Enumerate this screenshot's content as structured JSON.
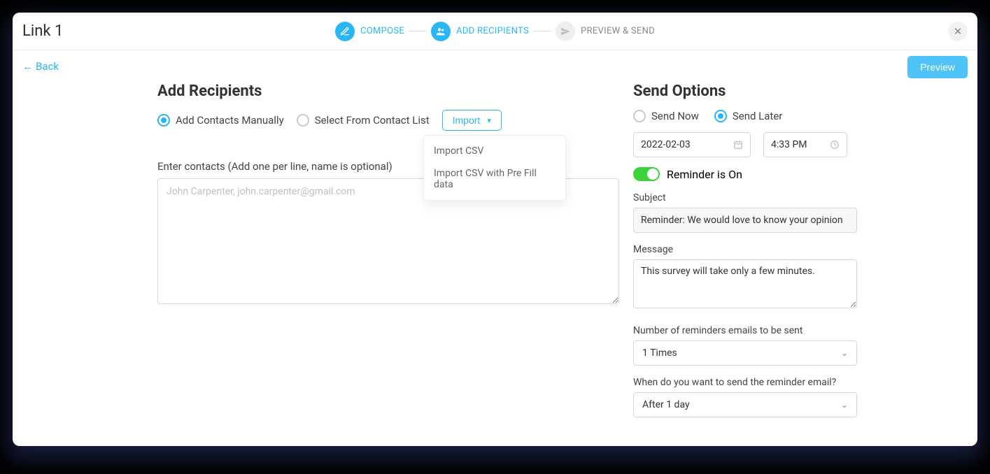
{
  "header": {
    "title": "Link 1",
    "steps": [
      {
        "label": "COMPOSE",
        "active": true
      },
      {
        "label": "ADD RECIPIENTS",
        "active": true
      },
      {
        "label": "PREVIEW & SEND",
        "active": false
      }
    ],
    "close_aria": "Close"
  },
  "subheader": {
    "back_label": "Back",
    "preview_label": "Preview"
  },
  "left": {
    "title": "Add Recipients",
    "radios": {
      "manual": "Add Contacts Manually",
      "from_list": "Select From Contact List"
    },
    "import_label": "Import",
    "import_menu": [
      "Import CSV",
      "Import CSV with Pre Fill data"
    ],
    "contacts_label": "Enter contacts (Add one per line, name is optional)",
    "contacts_placeholder": "John Carpenter, john.carpenter@gmail.com"
  },
  "right": {
    "title": "Send Options",
    "send_radios": {
      "now": "Send Now",
      "later": "Send Later"
    },
    "date_value": "2022-02-03",
    "time_value": "4:33 PM",
    "reminder_toggle_label": "Reminder is On",
    "subject_label": "Subject",
    "subject_value": "Reminder: We would love to know your opinion",
    "message_label": "Message",
    "message_value": "This survey will take only a few minutes.",
    "num_reminders_label": "Number of reminders emails to be sent",
    "num_reminders_value": "1 Times",
    "when_label": "When do you want to send the reminder email?",
    "when_value": "After 1 day"
  }
}
